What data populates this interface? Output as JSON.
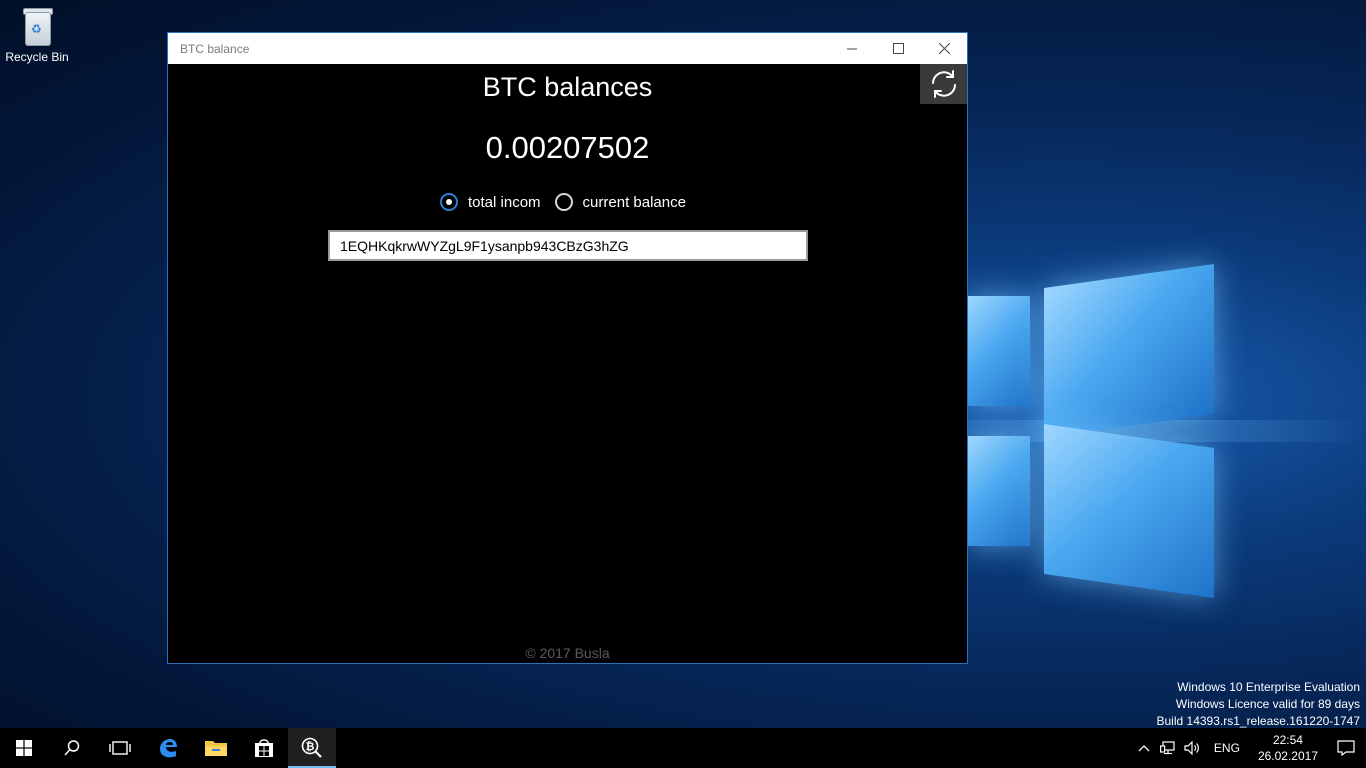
{
  "desktop": {
    "icons": [
      {
        "label": "Recycle Bin",
        "icon": "recycle-bin-icon"
      }
    ],
    "watermark": [
      "Windows 10 Enterprise Evaluation",
      "Windows Licence valid for 89 days",
      "Build 14393.rs1_release.161220-1747"
    ]
  },
  "window": {
    "title": "BTC balance",
    "controls": {
      "minimize": "minimize-icon",
      "maximize": "maximize-icon",
      "close": "close-icon"
    },
    "heading": "BTC balances",
    "refresh_icon": "refresh-icon",
    "balance": "0.00207502",
    "radio_options": [
      {
        "label": "total incom",
        "checked": true
      },
      {
        "label": "current balance",
        "checked": false
      }
    ],
    "address_value": "1EQHKqkrwWYZgL9F1ysanpb943CBzG3hZG",
    "footer": "© 2017 Busla"
  },
  "taskbar": {
    "buttons": [
      "start-icon",
      "search-icon",
      "task-view-icon",
      "edge-icon",
      "file-explorer-icon",
      "store-icon",
      "btc-balance-app-icon"
    ],
    "active_app": "btc-balance-app-icon",
    "tray": {
      "icons": [
        "show-hidden-icons-chevron",
        "network-icon",
        "volume-icon"
      ],
      "language": "ENG",
      "time": "22:54",
      "date": "26.02.2017",
      "notifications_icon": "action-center-icon"
    }
  },
  "colors": {
    "accent": "#2a7fd4",
    "window_bg": "#000000",
    "titlebar_bg": "#ffffff",
    "taskbar_bg": "#000000"
  }
}
